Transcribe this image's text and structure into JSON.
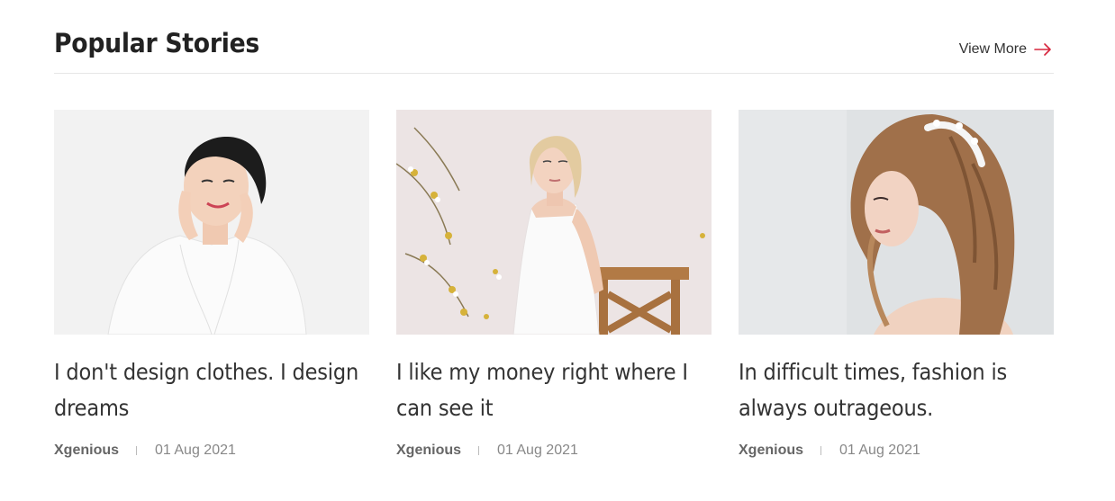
{
  "section": {
    "title": "Popular Stories",
    "view_more_label": "View More",
    "accent_color": "#d7263d"
  },
  "cards": [
    {
      "title": "I don't design clothes. I design dreams",
      "author": "Xgenious",
      "date": "01 Aug 2021",
      "image_desc": "woman-in-white-robe-touching-face"
    },
    {
      "title": "I like my money right where I can see it",
      "author": "Xgenious",
      "date": "01 Aug 2021",
      "image_desc": "blonde-woman-white-dress-wooden-chair"
    },
    {
      "title": "In difficult times, fashion is always outrageous.",
      "author": "Xgenious",
      "date": "01 Aug 2021",
      "image_desc": "woman-curly-hair-tiara-profile"
    }
  ]
}
